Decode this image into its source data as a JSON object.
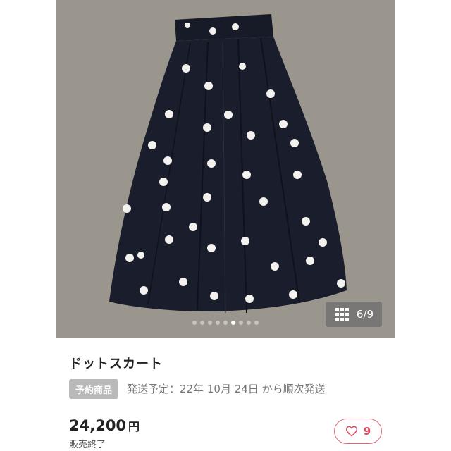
{
  "gallery": {
    "counter": "6/9",
    "image_count": 9,
    "current_index": 6
  },
  "product": {
    "title": "ドットスカート",
    "badge": "予約商品",
    "shipping": "発送予定：22年 10月 24日 から順次発送",
    "price": "24,200",
    "currency": "円",
    "status": "販売終了"
  },
  "like": {
    "count": "9",
    "color": "#e3485f"
  },
  "icons": {
    "gallery_grid": "grid-icon",
    "like": "heart-icon"
  },
  "colors": {
    "photo_background": "#9a958c",
    "skirt": "#1a1e2c",
    "polka_dot": "#ffffff"
  }
}
